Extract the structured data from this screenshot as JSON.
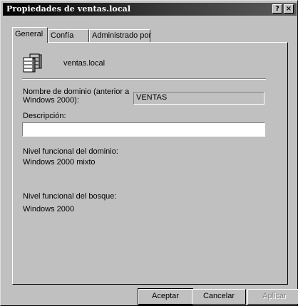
{
  "window": {
    "title": "Propiedades de ventas.local",
    "help_label": "?",
    "close_label": "×"
  },
  "tabs": [
    {
      "label": "General",
      "active": true
    },
    {
      "label": "Confía",
      "active": false
    },
    {
      "label": "Administrado por",
      "active": false
    }
  ],
  "general": {
    "icon": "domain-server-icon",
    "domain_name": "ventas.local",
    "prev_name_label_line1": "Nombre de dominio (anterior a",
    "prev_name_label_line2": "Windows 2000):",
    "prev_name_value": "VENTAS",
    "description_label": "Descripción:",
    "description_value": "",
    "domain_level_label": "Nivel funcional del dominio:",
    "domain_level_value": "Windows 2000 mixto",
    "forest_level_label": "Nivel funcional del bosque:",
    "forest_level_value": "Windows 2000"
  },
  "buttons": {
    "ok": "Aceptar",
    "cancel": "Cancelar",
    "apply": "Aplicar"
  }
}
